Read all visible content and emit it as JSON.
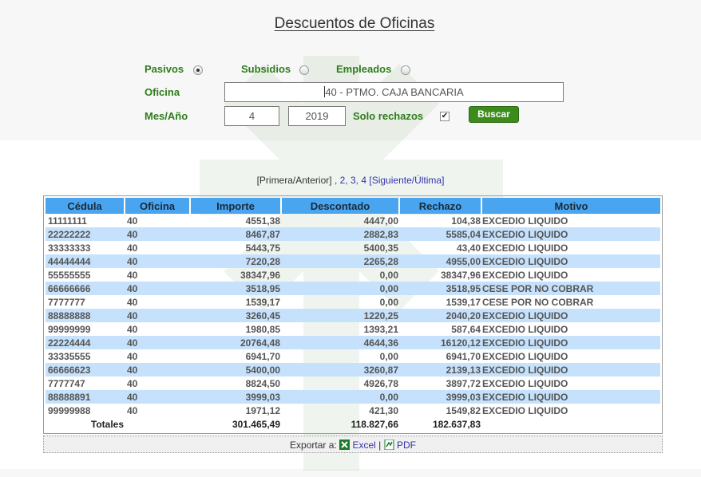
{
  "title": "Descuentos de Oficinas",
  "filters": {
    "pasivos_label": "Pasivos",
    "subsidios_label": "Subsidios",
    "empleados_label": "Empleados",
    "selected_type": "Pasivos",
    "oficina_label": "Oficina",
    "oficina_value": "40 - PTMO. CAJA BANCARIA",
    "mesanio_label": "Mes/Año",
    "mes_value": "4",
    "anio_value": "2019",
    "solo_rechazos_label": "Solo rechazos",
    "solo_rechazos_checked": true,
    "buscar_label": "Buscar"
  },
  "pager": {
    "first_prev": "[Primera/Anterior]",
    "sep": ",",
    "pages": [
      "2",
      "3",
      "4"
    ],
    "next_last": "[Siguiente/Última]"
  },
  "table": {
    "headers": [
      "Cédula",
      "Oficina",
      "Importe",
      "Descontado",
      "Rechazo",
      "Motivo"
    ],
    "rows": [
      [
        "11111111",
        "40",
        "4551,38",
        "4447,00",
        "104,38",
        "EXCEDIO LIQUIDO"
      ],
      [
        "22222222",
        "40",
        "8467,87",
        "2882,83",
        "5585,04",
        "EXCEDIO LIQUIDO"
      ],
      [
        "33333333",
        "40",
        "5443,75",
        "5400,35",
        "43,40",
        "EXCEDIO LIQUIDO"
      ],
      [
        "44444444",
        "40",
        "7220,28",
        "2265,28",
        "4955,00",
        "EXCEDIO LIQUIDO"
      ],
      [
        "55555555",
        "40",
        "38347,96",
        "0,00",
        "38347,96",
        "EXCEDIO LIQUIDO"
      ],
      [
        "66666666",
        "40",
        "3518,95",
        "0,00",
        "3518,95",
        "CESE POR NO COBRAR"
      ],
      [
        "7777777",
        "40",
        "1539,17",
        "0,00",
        "1539,17",
        "CESE POR NO COBRAR"
      ],
      [
        "88888888",
        "40",
        "3260,45",
        "1220,25",
        "2040,20",
        "EXCEDIO LIQUIDO"
      ],
      [
        "99999999",
        "40",
        "1980,85",
        "1393,21",
        "587,64",
        "EXCEDIO LIQUIDO"
      ],
      [
        "22224444",
        "40",
        "20764,48",
        "4644,36",
        "16120,12",
        "EXCEDIO LIQUIDO"
      ],
      [
        "33335555",
        "40",
        "6941,70",
        "0,00",
        "6941,70",
        "EXCEDIO LIQUIDO"
      ],
      [
        "66666623",
        "40",
        "5400,00",
        "3260,87",
        "2139,13",
        "EXCEDIO LIQUIDO"
      ],
      [
        "7777747",
        "40",
        "8824,50",
        "4926,78",
        "3897,72",
        "EXCEDIO LIQUIDO"
      ],
      [
        "88888891",
        "40",
        "3999,03",
        "0,00",
        "3999,03",
        "EXCEDIO LIQUIDO"
      ],
      [
        "99999988",
        "40",
        "1971,12",
        "421,30",
        "1549,82",
        "EXCEDIO LIQUIDO"
      ]
    ],
    "totals": {
      "label": "Totales",
      "importe": "301.465,49",
      "descontado": "118.827,66",
      "rechazo": "182.637,83"
    }
  },
  "export": {
    "label": "Exportar a:",
    "excel": "Excel",
    "sep": "|",
    "pdf": "PDF"
  },
  "colors": {
    "label_green": "#2e7d1a",
    "button_green": "#3d8c1b",
    "header_blue": "#4aa5f0",
    "row_alt_blue": "#c5e1fb",
    "link_blue": "#3333aa"
  },
  "icons": {
    "watermark": "watermark-logo",
    "excel": "excel-icon",
    "pdf": "pdf-icon"
  }
}
